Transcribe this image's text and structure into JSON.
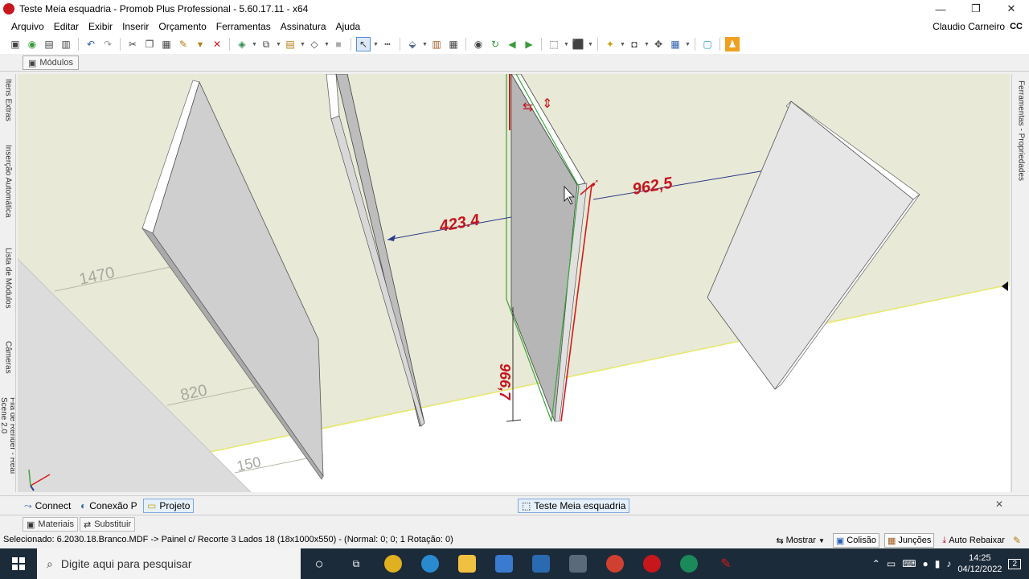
{
  "window": {
    "title": "Teste Meia esquadria - Promob Plus Professional - 5.60.17.11 - x64",
    "minimize": "—",
    "restore": "❐",
    "close": "✕"
  },
  "menu": [
    "Arquivo",
    "Editar",
    "Exibir",
    "Inserir",
    "Orçamento",
    "Ferramentas",
    "Assinatura",
    "Ajuda"
  ],
  "user": {
    "name": "Claudio Carneiro",
    "initials": "CC"
  },
  "doc_tab": "Módulos",
  "left_panels": [
    "Itens Extras",
    "Inserção Automática",
    "Lista de Módulos",
    "Câmeras",
    "Fila de Render - Real Scene 2.0"
  ],
  "right_panels": [
    "Ferramentas - Propriedades"
  ],
  "viewport": {
    "dimensions": {
      "top_span": "962,5",
      "middle_span": "423.4",
      "height": "966,7"
    },
    "floor_marks": [
      "1470",
      "820",
      "150"
    ]
  },
  "bottom_tabs": {
    "connect": "Connect",
    "conexao": "Conexão P",
    "projeto": "Projeto",
    "scene": "Teste Meia esquadria"
  },
  "material_tabs": {
    "materiais": "Materiais",
    "substituir": "Substituir"
  },
  "status": {
    "text": "Selecionado: 6.2030.18.Branco.MDF -> Painel c/ Recorte 3 Lados 18 (18x1000x550) - (Normal: 0; 0; 1 Rotação: 0)",
    "mostrar": "Mostrar",
    "colisao": "Colisão",
    "juncoes": "Junções",
    "auto_rebaixar": "Auto Rebaixar"
  },
  "taskbar": {
    "search_placeholder": "Digite aqui para pesquisar",
    "time": "14:25",
    "date": "04/12/2022",
    "notifications": "2"
  },
  "colors": {
    "dimension_red": "#c8141e",
    "dimension_line": "#2b3a8a",
    "wall": "#e9eadb",
    "floor_line": "#e6e86a"
  }
}
